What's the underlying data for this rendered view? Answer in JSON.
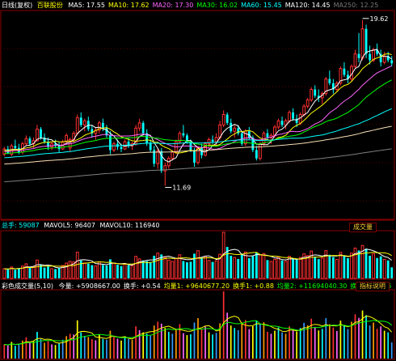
{
  "header": {
    "period": "日线(复权)",
    "stock_name": "百联股份",
    "ma_items": [
      {
        "label": "MA5: 17.55",
        "color": "#ffffff"
      },
      {
        "label": "MA10: 17.62",
        "color": "#ffff00"
      },
      {
        "label": "MA20: 17.30",
        "color": "#ff66ff"
      },
      {
        "label": "MA30: 16.02",
        "color": "#00ff00"
      },
      {
        "label": "MA60: 15.45",
        "color": "#00ffff"
      },
      {
        "label": "MA120: 14.45",
        "color": "#ffffff"
      },
      {
        "label": "MA250: 12.25",
        "color": "#777777"
      }
    ]
  },
  "volume_header": {
    "title": "总手: 59087",
    "mavol5": "MAVOL5: 96407",
    "mavol10": "MAVOL10: 116940",
    "button": "成交量"
  },
  "indicator_header": {
    "title": "彩色成交量(5,10)",
    "items": [
      {
        "label": "今量: +5908667.00",
        "color": "#ffffff"
      },
      {
        "label": "换手: +0.54",
        "color": "#ffffff"
      },
      {
        "label": "均量1: +9640677.20",
        "color": "#ffff00"
      },
      {
        "label": "换手1: +0.88",
        "color": "#ffff00"
      },
      {
        "label": "均量2: +11694040.30",
        "color": "#00ff00"
      },
      {
        "label": "换手2: +1.06",
        "color": "#00ff00"
      }
    ],
    "button": "指标说明"
  },
  "chart_data": {
    "type": "candlestick",
    "price_panel": {
      "ylim": [
        10.2,
        20.0
      ],
      "annotations": [
        {
          "text": "19.62",
          "index": 98,
          "value": 19.62,
          "kind": "high"
        },
        {
          "text": "11.69",
          "index": 44,
          "value": 11.69,
          "kind": "low"
        }
      ],
      "ohlc": [
        [
          13.2,
          13.55,
          13.1,
          13.45
        ],
        [
          13.45,
          13.6,
          13.2,
          13.25
        ],
        [
          13.2,
          13.7,
          13.1,
          13.6
        ],
        [
          13.6,
          13.9,
          13.4,
          13.5
        ],
        [
          13.5,
          13.7,
          13.2,
          13.3
        ],
        [
          13.3,
          13.8,
          13.2,
          13.7
        ],
        [
          13.7,
          14.1,
          13.6,
          13.95
        ],
        [
          13.95,
          14.05,
          13.6,
          13.7
        ],
        [
          13.7,
          14.0,
          13.5,
          13.85
        ],
        [
          13.85,
          14.6,
          13.8,
          14.4
        ],
        [
          14.4,
          14.5,
          13.9,
          14.0
        ],
        [
          14.0,
          14.2,
          13.7,
          13.8
        ],
        [
          13.8,
          14.0,
          13.4,
          13.55
        ],
        [
          13.55,
          13.8,
          13.4,
          13.7
        ],
        [
          13.7,
          13.9,
          13.5,
          13.6
        ],
        [
          13.6,
          13.8,
          13.3,
          13.45
        ],
        [
          13.45,
          13.9,
          13.4,
          13.8
        ],
        [
          13.8,
          14.2,
          13.7,
          14.1
        ],
        [
          13.5,
          14.0,
          13.3,
          13.9
        ],
        [
          13.9,
          14.3,
          13.8,
          14.2
        ],
        [
          14.2,
          15.1,
          14.1,
          14.95
        ],
        [
          14.95,
          15.2,
          14.5,
          14.6
        ],
        [
          14.6,
          14.9,
          14.3,
          14.8
        ],
        [
          14.8,
          15.0,
          14.3,
          14.4
        ],
        [
          14.4,
          14.6,
          14.0,
          14.2
        ],
        [
          14.2,
          14.5,
          13.9,
          14.35
        ],
        [
          14.35,
          14.8,
          14.2,
          14.7
        ],
        [
          14.7,
          14.9,
          14.3,
          14.45
        ],
        [
          14.45,
          14.6,
          14.0,
          14.1
        ],
        [
          14.1,
          14.3,
          13.2,
          13.4
        ],
        [
          13.4,
          13.8,
          13.3,
          13.7
        ],
        [
          13.7,
          13.9,
          13.4,
          13.55
        ],
        [
          13.55,
          13.7,
          13.3,
          13.45
        ],
        [
          13.45,
          13.9,
          13.4,
          13.8
        ],
        [
          13.8,
          14.0,
          13.5,
          13.6
        ],
        [
          13.6,
          13.8,
          13.4,
          13.7
        ],
        [
          13.7,
          14.6,
          13.6,
          14.45
        ],
        [
          14.45,
          14.9,
          14.3,
          14.7
        ],
        [
          14.7,
          14.8,
          14.1,
          14.2
        ],
        [
          14.2,
          14.4,
          13.6,
          13.75
        ],
        [
          13.75,
          13.9,
          13.3,
          13.4
        ],
        [
          13.4,
          13.6,
          12.6,
          12.75
        ],
        [
          12.75,
          13.5,
          12.5,
          13.35
        ],
        [
          13.35,
          13.5,
          12.3,
          12.4
        ],
        [
          12.4,
          12.8,
          11.69,
          12.65
        ],
        [
          12.65,
          13.1,
          12.5,
          13.0
        ],
        [
          13.0,
          13.4,
          12.9,
          13.3
        ],
        [
          13.3,
          13.9,
          13.2,
          13.8
        ],
        [
          13.8,
          14.3,
          13.7,
          14.2
        ],
        [
          14.2,
          14.6,
          14.0,
          14.1
        ],
        [
          14.1,
          14.2,
          13.7,
          13.8
        ],
        [
          13.8,
          13.9,
          13.3,
          13.4
        ],
        [
          13.4,
          13.5,
          12.6,
          12.8
        ],
        [
          12.8,
          13.6,
          12.7,
          13.5
        ],
        [
          13.5,
          13.7,
          13.0,
          13.15
        ],
        [
          13.15,
          13.8,
          13.1,
          13.7
        ],
        [
          13.7,
          14.0,
          13.5,
          13.9
        ],
        [
          13.9,
          14.1,
          13.7,
          13.8
        ],
        [
          13.8,
          14.2,
          13.6,
          14.0
        ],
        [
          14.0,
          14.8,
          13.9,
          14.6
        ],
        [
          14.6,
          15.3,
          14.5,
          15.1
        ],
        [
          15.1,
          15.2,
          14.6,
          14.7
        ],
        [
          14.7,
          14.9,
          14.2,
          14.3
        ],
        [
          14.3,
          14.6,
          14.0,
          14.45
        ],
        [
          14.45,
          14.6,
          14.1,
          14.2
        ],
        [
          14.2,
          14.3,
          13.6,
          13.7
        ],
        [
          13.7,
          14.4,
          13.6,
          14.3
        ],
        [
          14.3,
          14.5,
          13.9,
          14.0
        ],
        [
          14.0,
          14.1,
          13.3,
          13.4
        ],
        [
          13.4,
          13.6,
          12.9,
          13.0
        ],
        [
          13.0,
          13.8,
          12.9,
          13.7
        ],
        [
          13.7,
          14.3,
          13.6,
          14.2
        ],
        [
          14.2,
          14.4,
          13.9,
          14.0
        ],
        [
          14.0,
          14.2,
          13.7,
          14.1
        ],
        [
          14.1,
          14.6,
          14.0,
          14.5
        ],
        [
          14.5,
          14.9,
          14.4,
          14.8
        ],
        [
          14.8,
          15.0,
          14.5,
          14.6
        ],
        [
          14.6,
          14.9,
          14.4,
          14.8
        ],
        [
          14.8,
          15.3,
          14.7,
          15.2
        ],
        [
          15.2,
          15.4,
          14.8,
          14.9
        ],
        [
          14.9,
          15.1,
          14.5,
          14.7
        ],
        [
          14.7,
          15.2,
          14.6,
          15.1
        ],
        [
          15.1,
          15.6,
          15.0,
          15.5
        ],
        [
          15.5,
          15.9,
          15.4,
          15.8
        ],
        [
          15.8,
          16.4,
          15.7,
          16.3
        ],
        [
          16.3,
          16.5,
          15.9,
          16.0
        ],
        [
          16.0,
          16.3,
          15.7,
          15.9
        ],
        [
          15.9,
          16.2,
          15.6,
          16.1
        ],
        [
          16.1,
          16.9,
          16.0,
          16.8
        ],
        [
          16.8,
          17.2,
          16.5,
          16.6
        ],
        [
          16.6,
          16.8,
          16.1,
          16.3
        ],
        [
          16.3,
          16.7,
          16.2,
          16.6
        ],
        [
          16.6,
          17.4,
          16.5,
          17.3
        ],
        [
          17.3,
          17.6,
          16.9,
          17.0
        ],
        [
          17.0,
          17.2,
          16.6,
          16.8
        ],
        [
          16.8,
          17.5,
          16.7,
          17.4
        ],
        [
          17.4,
          18.2,
          17.3,
          18.0
        ],
        [
          18.0,
          19.0,
          17.6,
          17.8
        ],
        [
          17.8,
          19.62,
          17.7,
          19.2
        ],
        [
          19.2,
          19.4,
          17.8,
          18.0
        ],
        [
          18.0,
          18.4,
          17.5,
          17.7
        ],
        [
          17.7,
          18.3,
          17.6,
          18.2
        ],
        [
          18.2,
          18.5,
          17.9,
          18.0
        ],
        [
          18.0,
          18.2,
          17.4,
          17.6
        ],
        [
          17.6,
          18.1,
          17.5,
          17.9
        ],
        [
          17.9,
          18.1,
          17.6,
          17.7
        ],
        [
          17.7,
          17.9,
          17.4,
          17.55
        ]
      ]
    },
    "volume_panel": {
      "series": [
        {
          "name": "MAVOL5",
          "color": "#ffffff"
        },
        {
          "name": "MAVOL10",
          "color": "#ffff00"
        }
      ],
      "values": [
        52000,
        48000,
        61000,
        47000,
        55000,
        66000,
        78000,
        59000,
        63000,
        98000,
        72000,
        58000,
        64000,
        52000,
        50000,
        57000,
        69000,
        82000,
        91000,
        88000,
        140000,
        96000,
        83000,
        79000,
        71000,
        67000,
        88000,
        72000,
        69000,
        102000,
        81000,
        73000,
        66000,
        79000,
        71000,
        68000,
        118000,
        104000,
        96000,
        92000,
        84000,
        121000,
        135000,
        128000,
        112000,
        98000,
        91000,
        107000,
        126000,
        93000,
        86000,
        89000,
        132000,
        148000,
        109000,
        117000,
        96000,
        88000,
        94000,
        129000,
        246000,
        168000,
        121000,
        112000,
        104000,
        132000,
        141000,
        108000,
        119000,
        138000,
        127000,
        133000,
        98000,
        91000,
        102000,
        114000,
        96000,
        91000,
        118000,
        104000,
        99000,
        112000,
        131000,
        122000,
        146000,
        116000,
        103000,
        109000,
        148000,
        126000,
        114000,
        101000,
        139000,
        121000,
        108000,
        135000,
        162000,
        149000,
        176000,
        159000,
        121000,
        132000,
        109000,
        118000,
        102000,
        96000,
        59087
      ]
    },
    "indicator_panel": {
      "series": [
        {
          "name": "均量1",
          "color": "#ffff00"
        },
        {
          "name": "均量2",
          "color": "#00ff00"
        }
      ]
    }
  }
}
